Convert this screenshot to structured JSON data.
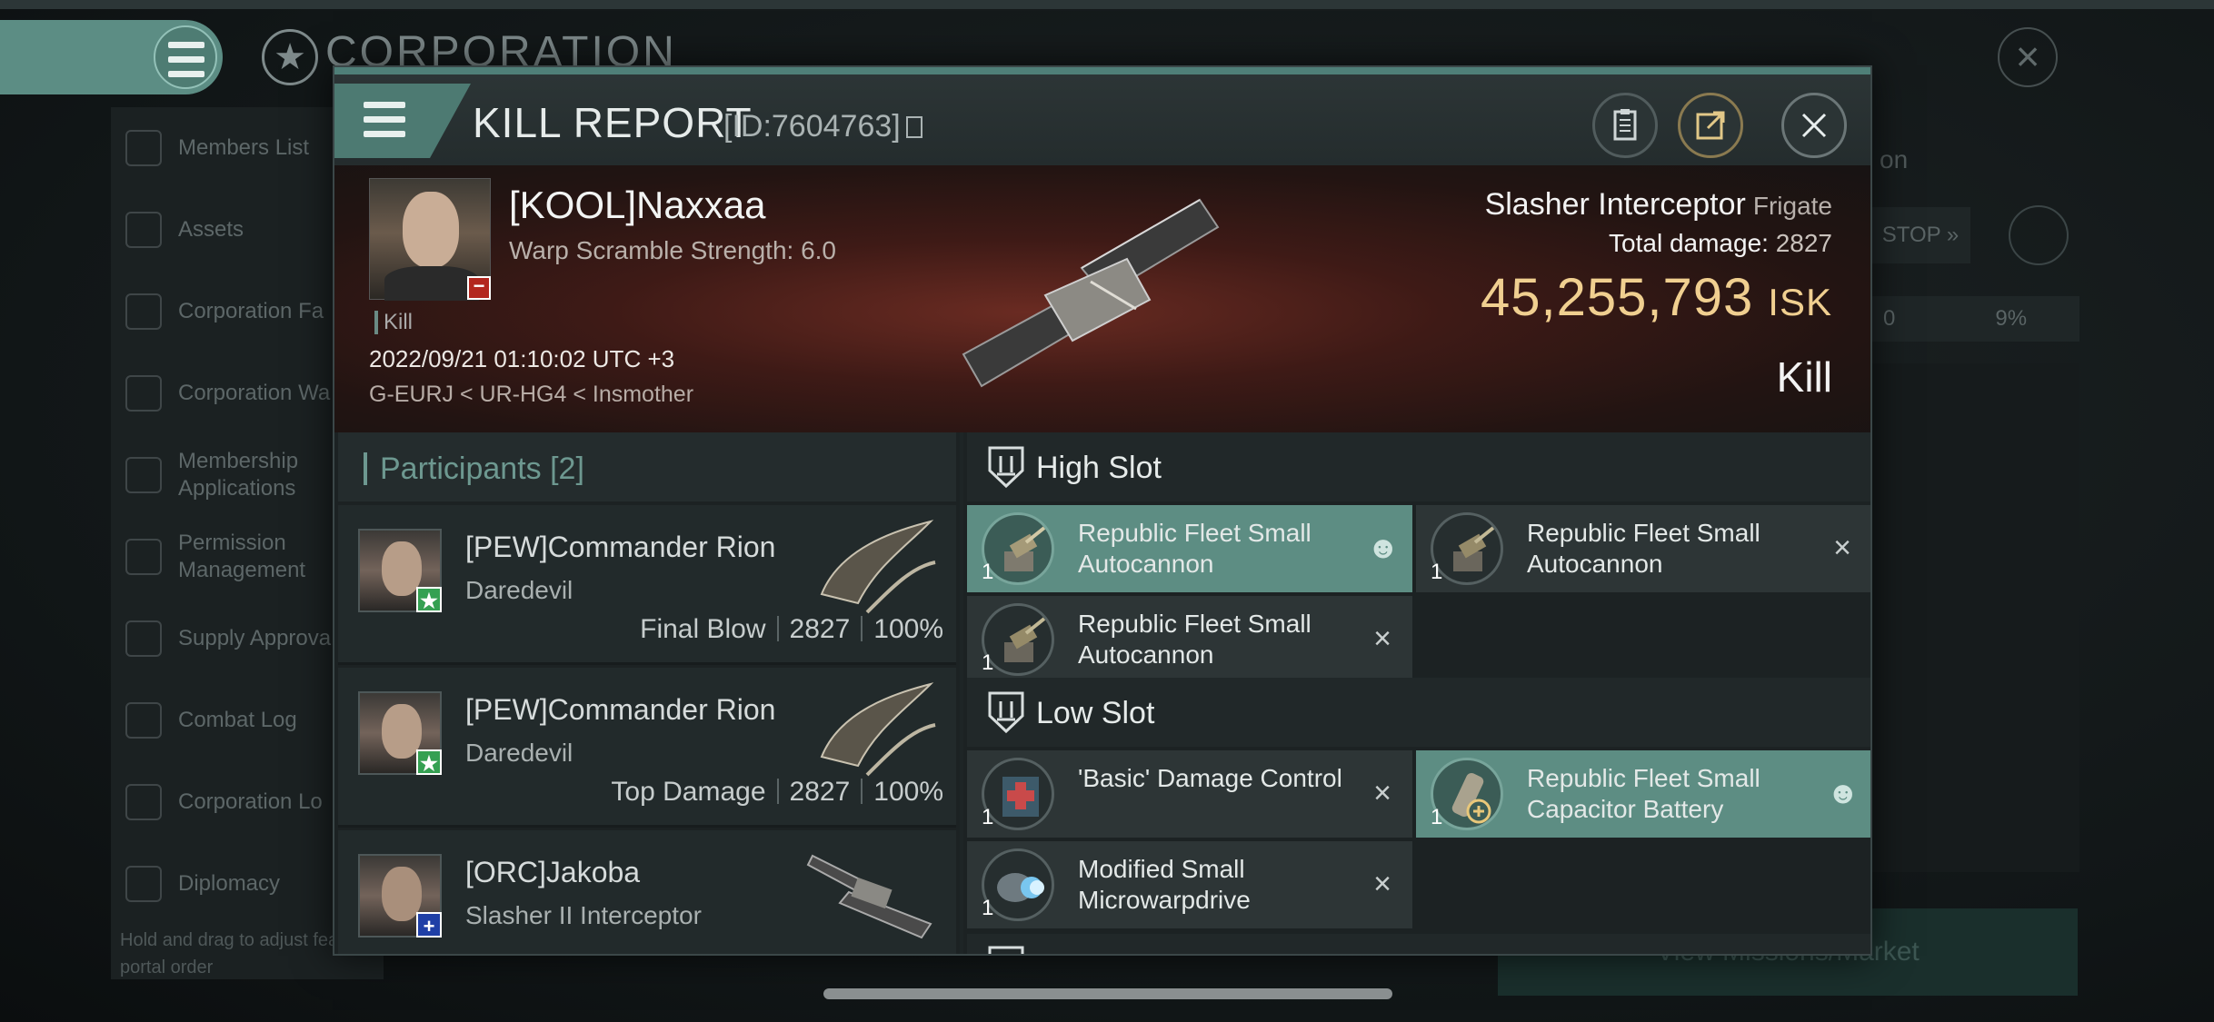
{
  "background": {
    "corp_title": "CORPORATION",
    "sidebar_items": [
      "Members List",
      "Assets",
      "Corporation Fa",
      "Corporation Wa",
      "Membership Applications",
      "Permission Management",
      "Supply Approva",
      "Combat Log",
      "Corporation Lo",
      "Diplomacy"
    ],
    "hint": "Hold and drag to adjust feature portal order",
    "right_text": "on",
    "stop_label": "STOP",
    "stat_a": "0",
    "stat_b": "9%",
    "missions_label": "View Missions/Market"
  },
  "modal": {
    "title": "KILL REPORT",
    "id_text": "[ID:7604763]"
  },
  "victim": {
    "name": "[KOOL]Naxxaa",
    "warp_scramble": "Warp Scramble Strength: 6.0",
    "kill_tag": "Kill",
    "datetime": "2022/09/21 01:10:02 UTC +3",
    "location": "G-EURJ < UR-HG4 < Insmother",
    "ship_name": "Slasher Interceptor",
    "ship_class": "Frigate",
    "total_damage_label": "Total damage:",
    "total_damage": "2827",
    "isk_value": "45,255,793",
    "isk_unit": "ISK",
    "kill_type": "Kill"
  },
  "participants": {
    "title": "Participants",
    "count": "[2]",
    "rows": [
      {
        "name": "[PEW]Commander Rion",
        "ship": "Daredevil",
        "label": "Final Blow",
        "damage": "2827",
        "percent": "100%"
      },
      {
        "name": "[PEW]Commander Rion",
        "ship": "Daredevil",
        "label": "Top Damage",
        "damage": "2827",
        "percent": "100%"
      },
      {
        "name": "[ORC]Jakoba",
        "ship": "Slasher II Interceptor",
        "label": "",
        "damage": "",
        "percent": ""
      }
    ]
  },
  "fitting": {
    "high_slot_title": "High Slot",
    "low_slot_title": "Low Slot",
    "high": [
      {
        "name": "Republic Fleet Small Autocannon",
        "qty": "1",
        "state": "person"
      },
      {
        "name": "Republic Fleet Small Autocannon",
        "qty": "1",
        "state": "x"
      },
      {
        "name": "Republic Fleet Small Autocannon",
        "qty": "1",
        "state": "x"
      }
    ],
    "low": [
      {
        "name": "'Basic' Damage Control",
        "qty": "1",
        "state": "x"
      },
      {
        "name": "Republic Fleet Small Capacitor Battery",
        "qty": "1",
        "state": "person"
      },
      {
        "name": "Modified Small Microwarpdrive",
        "qty": "1",
        "state": "x"
      }
    ]
  },
  "colors": {
    "accent": "#5d8d83",
    "isk": "#f0cf90",
    "loss_badge": "#b3261e"
  }
}
